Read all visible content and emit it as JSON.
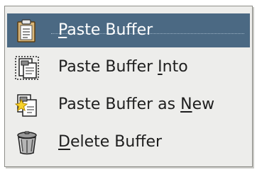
{
  "menu": {
    "items": [
      {
        "pre": "",
        "mnemonic": "P",
        "post": "aste Buffer",
        "icon": "paste-clipboard-icon",
        "selected": true
      },
      {
        "pre": "Paste Buffer ",
        "mnemonic": "I",
        "post": "nto",
        "icon": "paste-into-icon",
        "selected": false
      },
      {
        "pre": "Paste Buffer as ",
        "mnemonic": "N",
        "post": "ew",
        "icon": "paste-as-new-icon",
        "selected": false
      },
      {
        "pre": "",
        "mnemonic": "D",
        "post": "elete Buffer",
        "icon": "delete-trash-can-icon",
        "selected": false
      }
    ]
  },
  "colors": {
    "menu_background": "#ededeb",
    "selection": "#4b6983",
    "selected_text": "#ffffff",
    "text": "#1e1e1e"
  }
}
